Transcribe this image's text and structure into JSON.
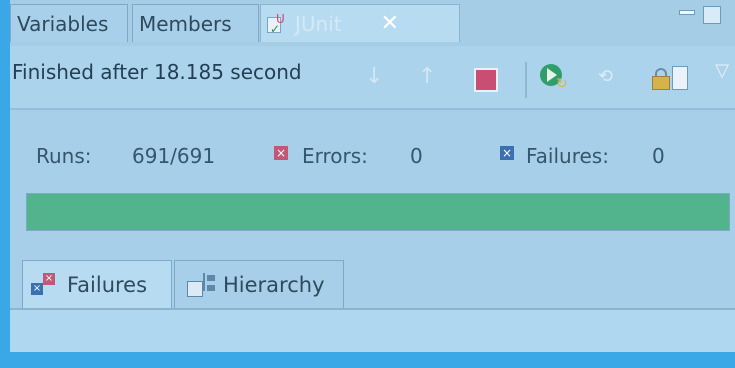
{
  "tabs": [
    {
      "label": "Variables"
    },
    {
      "label": "Members"
    },
    {
      "label": "JUnit",
      "close": "✕",
      "active": true
    }
  ],
  "toolbar": {
    "status": "Finished after 18.185 second",
    "menu_chevron": "▽"
  },
  "counters": {
    "runs_label": "Runs:",
    "runs_value": "691/691",
    "errors_label": "Errors:",
    "errors_value": "0",
    "failures_label": "Failures:",
    "failures_value": "0"
  },
  "progress": {
    "fraction": 1.0,
    "color": "#52b48d"
  },
  "subtabs": [
    {
      "label": "Failures",
      "active": true
    },
    {
      "label": "Hierarchy"
    }
  ],
  "icons": {
    "stop_color": "#c84f73",
    "error_color": "#c25777",
    "failure_color": "#3a6fb1"
  }
}
